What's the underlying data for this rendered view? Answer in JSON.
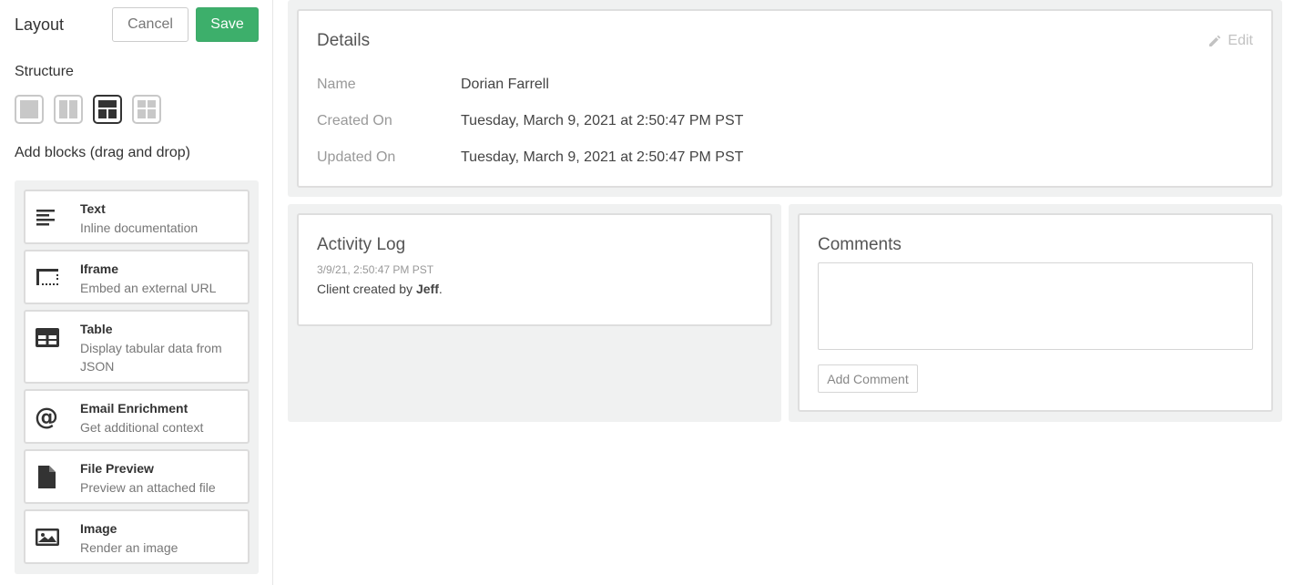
{
  "sidebar": {
    "title": "Layout",
    "cancel_label": "Cancel",
    "save_label": "Save",
    "structure_label": "Structure",
    "structure_options": [
      "single-column-icon",
      "two-column-icon",
      "top-two-bottom-icon",
      "grid-icon"
    ],
    "add_blocks_label": "Add blocks (drag and drop)",
    "blocks": [
      {
        "name": "Text",
        "desc": "Inline documentation",
        "icon": "text-align-icon"
      },
      {
        "name": "Iframe",
        "desc": "Embed an external URL",
        "icon": "iframe-icon"
      },
      {
        "name": "Table",
        "desc": "Display tabular data from JSON",
        "icon": "table-icon"
      },
      {
        "name": "Email Enrichment",
        "desc": "Get additional context",
        "icon": "at-sign-icon"
      },
      {
        "name": "File Preview",
        "desc": "Preview an attached file",
        "icon": "file-icon"
      },
      {
        "name": "Image",
        "desc": "Render an image",
        "icon": "image-icon"
      }
    ]
  },
  "details": {
    "title": "Details",
    "edit_label": "Edit",
    "rows": [
      {
        "label": "Name",
        "value": "Dorian Farrell"
      },
      {
        "label": "Created On",
        "value": "Tuesday, March 9, 2021 at 2:50:47 PM PST"
      },
      {
        "label": "Updated On",
        "value": "Tuesday, March 9, 2021 at 2:50:47 PM PST"
      }
    ]
  },
  "activity": {
    "title": "Activity Log",
    "time": "3/9/21, 2:50:47 PM PST",
    "text_prefix": "Client created by ",
    "text_user": "Jeff",
    "text_suffix": "."
  },
  "comments": {
    "title": "Comments",
    "input_value": "",
    "add_label": "Add Comment"
  },
  "colors": {
    "accent": "#3daf6b",
    "panel_bg": "#f0f1f1"
  }
}
